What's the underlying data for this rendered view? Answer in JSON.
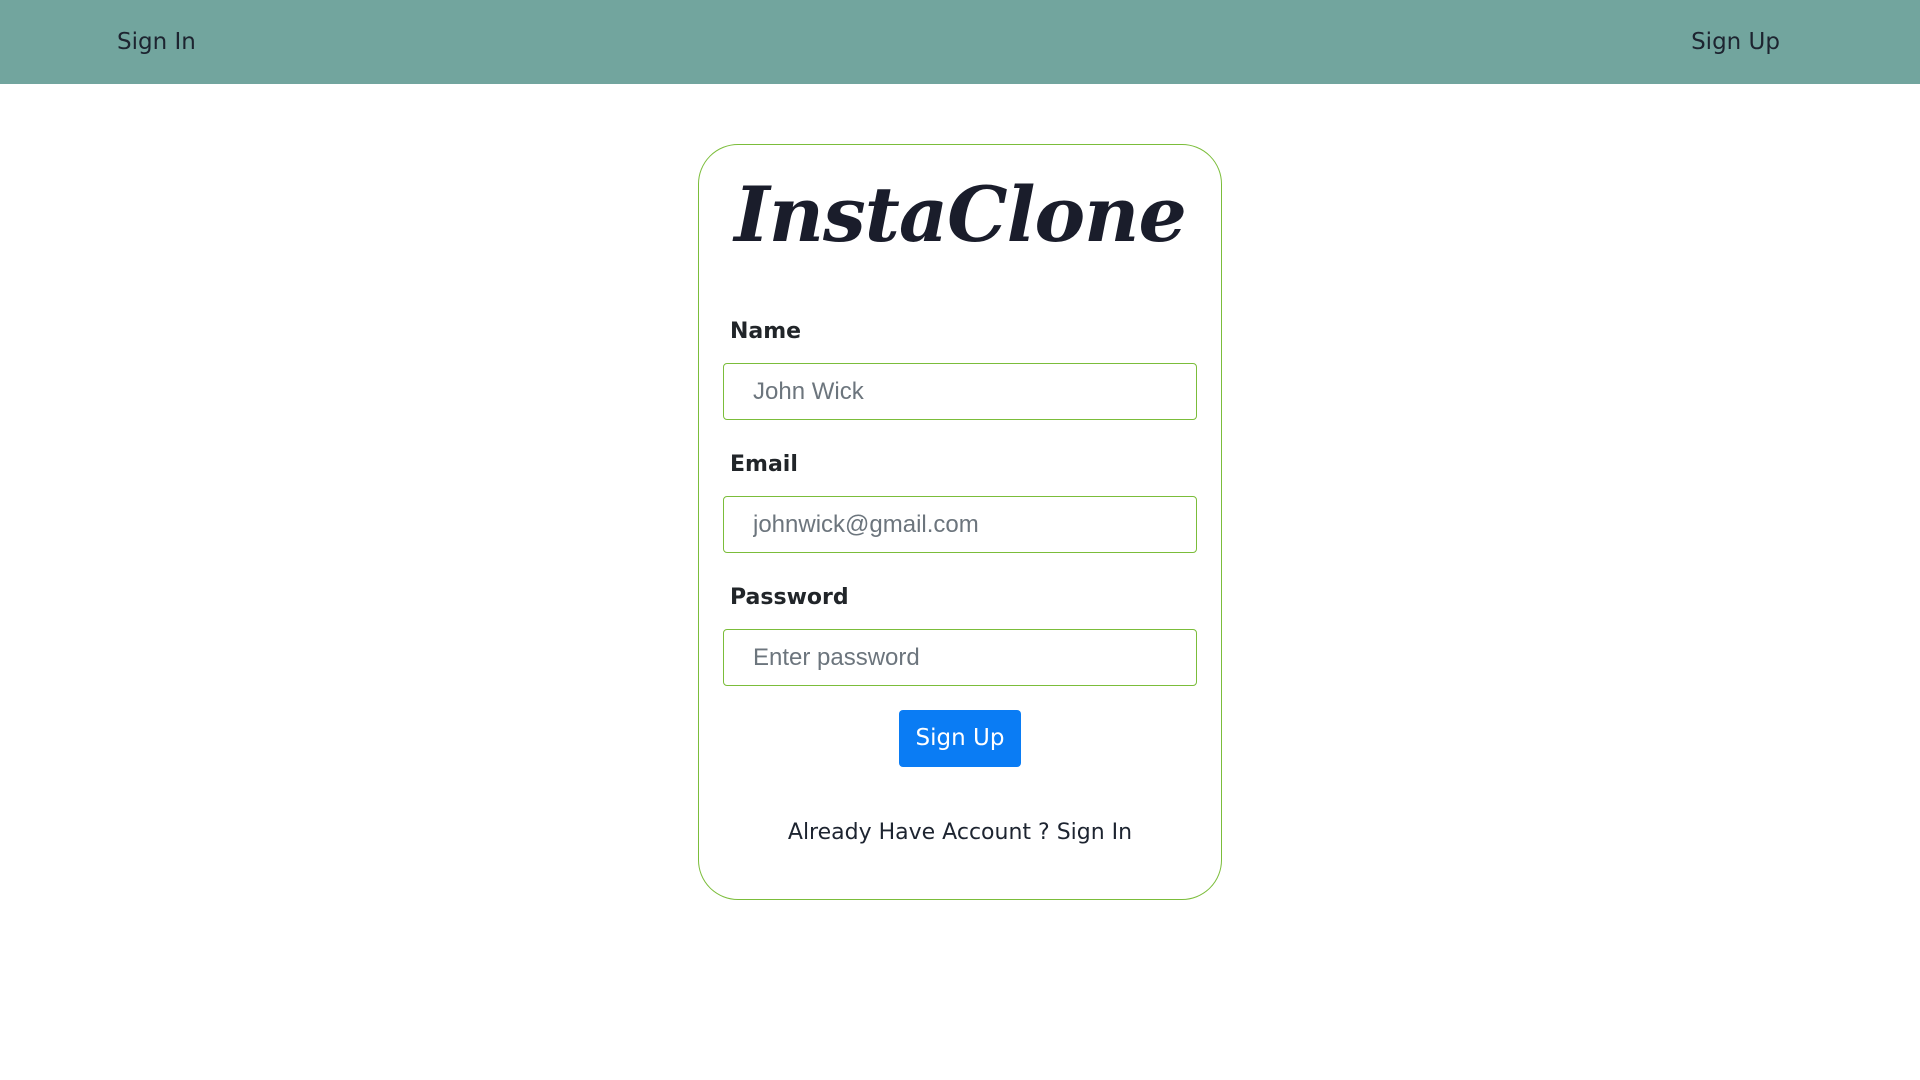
{
  "navbar": {
    "sign_in_label": "Sign In",
    "sign_up_label": "Sign Up",
    "background_color": "#72a59e"
  },
  "card": {
    "logo_text": "InstaClone",
    "border_color": "#7bbd3a",
    "fields": {
      "name": {
        "label": "Name",
        "value": "",
        "placeholder": "John Wick"
      },
      "email": {
        "label": "Email",
        "value": "",
        "placeholder": "johnwick@gmail.com"
      },
      "password": {
        "label": "Password",
        "value": "",
        "placeholder": "Enter password"
      }
    },
    "submit_label": "Sign Up",
    "submit_color": "#0a7cf4",
    "footer_prompt": "Already Have Account ?",
    "footer_link": "Sign In"
  }
}
